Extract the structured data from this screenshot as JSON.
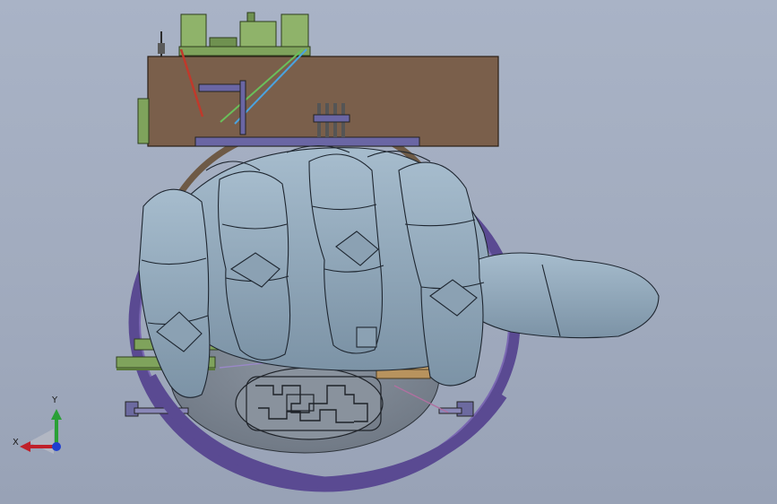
{
  "viewport": {
    "background_top": "#a9b3c6",
    "background_bottom": "#98a2b6"
  },
  "model": {
    "colors": {
      "hand_skin": "#93aabc",
      "hand_shadow": "#6f8597",
      "hand_edges": "#1e2630",
      "wood_block": "#7a5f4b",
      "pcb_green": "#7fa35c",
      "ring_purple": "#5a4a92",
      "base_dark": "#7d8692",
      "tendon_red": "#c0392b",
      "tendon_green": "#6abf5a",
      "tendon_blue": "#4aa3e0"
    }
  },
  "triad": {
    "x_label": "X",
    "y_label": "Y",
    "x_color": "#c0202a",
    "y_color": "#2aa036",
    "z_color": "#1f3fd0"
  }
}
